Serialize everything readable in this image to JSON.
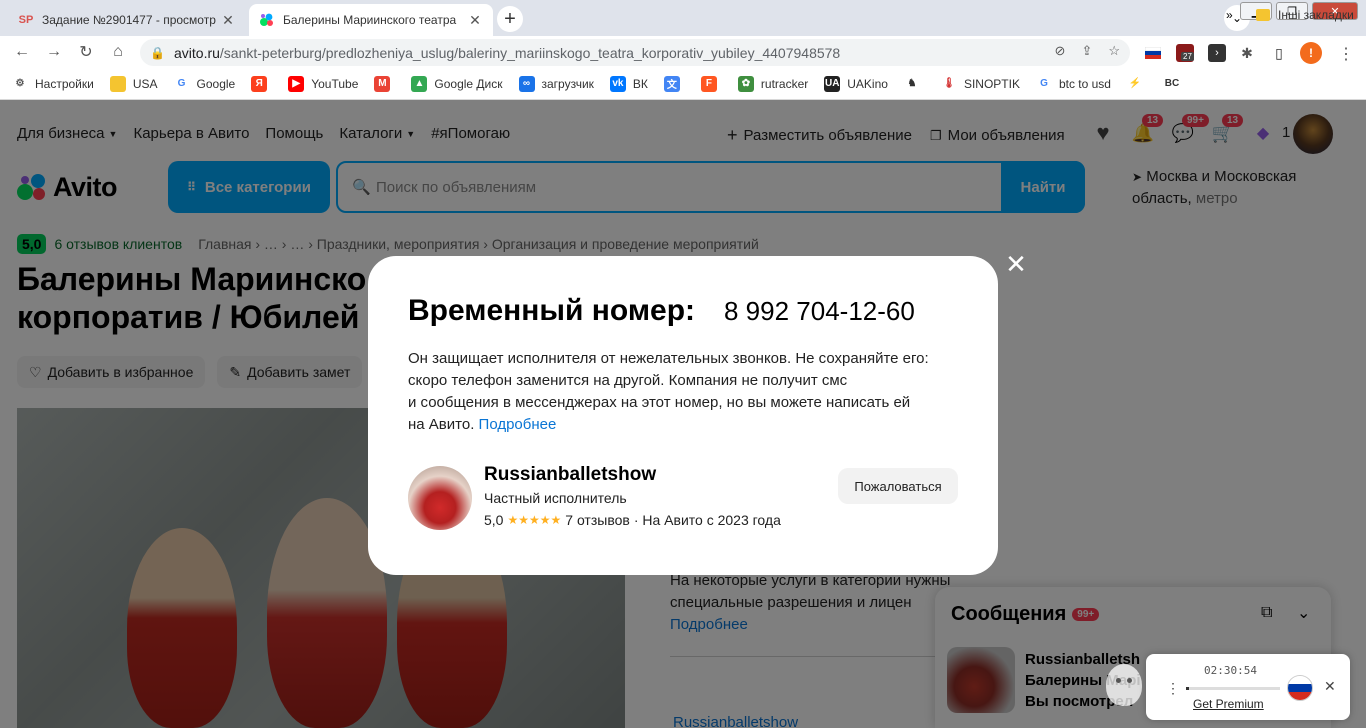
{
  "browser": {
    "tabs": [
      {
        "favicon": "SP",
        "title": "Задание №2901477 - просмотр",
        "active": false
      },
      {
        "favicon": "avito-dots",
        "title": "Балерины Мариинского театра",
        "active": true
      }
    ],
    "url_host": "avito.ru",
    "url_path": "/sankt-peterburg/predlozheniya_uslug/baleriny_mariinskogo_teatra_korporativ_yubiley_4407948578",
    "ext_badge": "27",
    "profile_initial": "!",
    "bookmarks": [
      {
        "label": "Настройки",
        "icon": "gear-icon",
        "color": "#555555"
      },
      {
        "label": "USA",
        "icon": "folder-icon",
        "color": "#f4c430"
      },
      {
        "label": "Google",
        "icon": "google-icon",
        "color": "#4285f4"
      },
      {
        "label": "",
        "icon": "yandex-icon",
        "color": "#fc3f1d"
      },
      {
        "label": "YouTube",
        "icon": "youtube-icon",
        "color": "#ff0000"
      },
      {
        "label": "",
        "icon": "gmail-icon",
        "color": "#ea4335"
      },
      {
        "label": "Google Диск",
        "icon": "drive-icon",
        "color": "#34a853"
      },
      {
        "label": "загрузчик",
        "icon": "downloader-icon",
        "color": "#1a73e8"
      },
      {
        "label": "ВК",
        "icon": "vk-icon",
        "color": "#0077ff"
      },
      {
        "label": "",
        "icon": "translate-icon",
        "color": "#4285f4"
      },
      {
        "label": "",
        "icon": "f-icon",
        "color": "#ff5722"
      },
      {
        "label": "rutracker",
        "icon": "rutracker-icon",
        "color": "#3f8f3f"
      },
      {
        "label": "UAKino",
        "icon": "uakino-icon",
        "color": "#222222"
      },
      {
        "label": "",
        "icon": "chess-icon",
        "color": "#333333"
      },
      {
        "label": "SINOPTIK",
        "icon": "thermometer-icon",
        "color": "#d32f2f"
      },
      {
        "label": "btc to usd",
        "icon": "google-icon",
        "color": "#4285f4"
      },
      {
        "label": "",
        "icon": "lightning-icon",
        "color": "#1565c0"
      },
      {
        "label": "",
        "icon": "bc-icon",
        "color": "#333333"
      }
    ],
    "bookmarks_more": "»",
    "other_bookmarks": "Інші закладки"
  },
  "site": {
    "topnav": [
      "Для бизнеса",
      "Карьера в Авито",
      "Помощь",
      "Каталоги",
      "#яПомогаю"
    ],
    "post_ad": "Разместить объявление",
    "my_ads": "Мои объявления",
    "notif_badge": "13",
    "messages_badge": "99+",
    "cart_badge": "13",
    "bonus_count": "1",
    "logo_word": "Avito",
    "all_categories": "Все категории",
    "search_placeholder": "Поиск по объявлениям",
    "search_button": "Найти",
    "location_main": "Москва и Московская область,",
    "location_metro": "метро",
    "rating": "5,0",
    "reviews_link": "6 отзывов клиентов",
    "breadcrumbs": "Главная › … › … › Праздники, мероприятия › Организация и проведение мероприятий",
    "title_line1": "Балерины Мариинско",
    "title_line2": "корпоратив / Юбилей",
    "add_favorite": "Добавить в избранное",
    "add_note": "Добавить замет",
    "info_line1": "На некоторые услуги в категории нужны",
    "info_line2": "специальные разрешения и лицен",
    "info_more": "Подробнее",
    "seller_link": "Russianballetshow"
  },
  "messenger": {
    "title": "Сообщения",
    "badge": "99+",
    "line1": "Russianballetsh",
    "line2": "Балерины Марі",
    "line3": "Вы посмотрел"
  },
  "modal": {
    "title": "Временный номер:",
    "phone": "8 992 704-12-60",
    "text_line1": "Он защищает исполнителя от нежелательных звонков. Не сохраняйте его:",
    "text_line2": "скоро телефон заменится на другой. Компания не получит смс",
    "text_line3": "и сообщения в мессенджерах на этот номер, но вы можете написать ей",
    "text_line4_prefix": "на Авито.",
    "text_more": "Подробнее",
    "seller_name": "Russianballetshow",
    "seller_role": "Частный исполнитель",
    "seller_rating": "5,0",
    "stars": "★★★★★",
    "reviews": "7 отзывов",
    "since": "· На Авито с 2023 года",
    "complain": "Пожаловаться"
  },
  "audio_widget": {
    "time": "02:30:54",
    "premium": "Get Premium",
    "progress": 0.03
  }
}
